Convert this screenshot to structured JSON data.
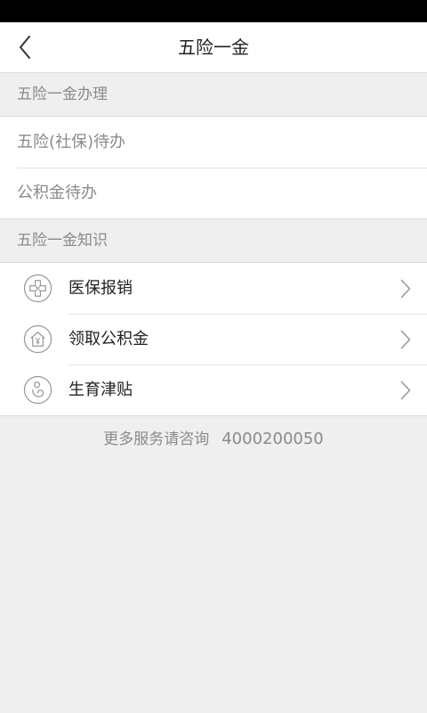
{
  "header": {
    "title": "五险一金"
  },
  "sections": {
    "handling": {
      "title": "五险一金办理",
      "items": [
        {
          "label": "五险(社保)待办"
        },
        {
          "label": "公积金待办"
        }
      ]
    },
    "knowledge": {
      "title": "五险一金知识",
      "items": [
        {
          "label": "医保报销",
          "icon": "medical-cross-icon"
        },
        {
          "label": "领取公积金",
          "icon": "house-yen-icon"
        },
        {
          "label": "生育津贴",
          "icon": "mother-baby-icon"
        }
      ]
    }
  },
  "footer": {
    "text": "更多服务请咨询",
    "phone": "4000200050"
  },
  "colors": {
    "status_bar": "#000000",
    "background": "#efefef",
    "surface": "#ffffff",
    "muted_text": "#8a8a8a",
    "primary_text": "#222222"
  }
}
